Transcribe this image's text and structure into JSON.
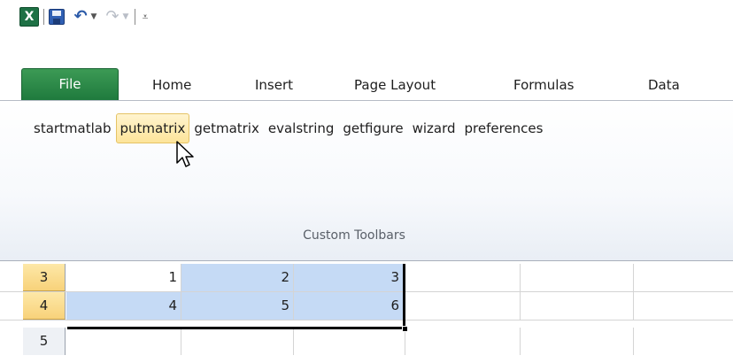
{
  "qat": {
    "app_icon_letter": "X",
    "icons": [
      "excel-icon",
      "save-icon",
      "undo-icon",
      "redo-icon",
      "customize-quick-access-icon"
    ],
    "undo_glyph": "↶",
    "redo_glyph": "↷",
    "caret_glyph": "▼",
    "customize_glyph": "⩡"
  },
  "tabs": {
    "file": "File",
    "home": "Home",
    "insert": "Insert",
    "page_layout": "Page Layout",
    "formulas": "Formulas",
    "data": "Data"
  },
  "ribbon": {
    "buttons": [
      "startmatlab",
      "putmatrix",
      "getmatrix",
      "evalstring",
      "getfigure",
      "wizard",
      "preferences"
    ],
    "active_button": "putmatrix",
    "group_label": "Custom Toolbars"
  },
  "grid": {
    "rows": [
      {
        "header": "3",
        "selected": true,
        "cells": [
          "1",
          "2",
          "3"
        ]
      },
      {
        "header": "4",
        "selected": true,
        "cells": [
          "4",
          "5",
          "6"
        ]
      },
      {
        "header": "5",
        "selected": false,
        "cells": [
          "",
          "",
          ""
        ]
      }
    ]
  },
  "colors": {
    "file_tab": "#1f7a3d",
    "selection_fill": "#c5daf5",
    "row_header_selected": "#f8d27a",
    "button_hover": "#fde49a"
  }
}
